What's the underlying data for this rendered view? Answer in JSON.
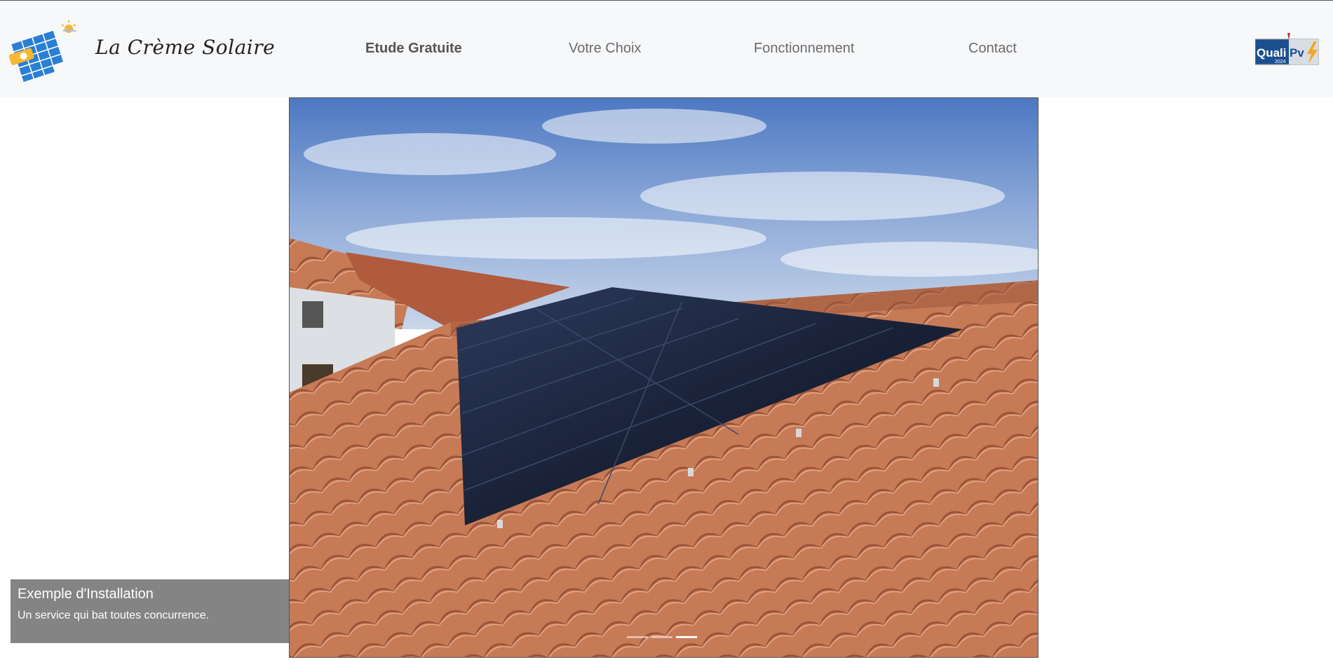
{
  "brand": {
    "name": "La Crème Solaire"
  },
  "nav": {
    "items": [
      {
        "label": "Etude Gratuite",
        "active": true
      },
      {
        "label": "Votre Choix",
        "active": false
      },
      {
        "label": "Fonctionnement",
        "active": false
      },
      {
        "label": "Contact",
        "active": false
      }
    ]
  },
  "badge": {
    "text_main": "Quali",
    "text_accent": "Pv",
    "year": "2024"
  },
  "hero": {
    "caption_title": "Exemple d'Installation",
    "caption_text": "Un service qui bat toutes concurrence.",
    "slides_total": 3,
    "active_slide": 3
  },
  "colors": {
    "navbar_bg": "#f7f8fa",
    "nav_text": "#6b6b6b",
    "caption_bg": "#6e6e6e",
    "badge_blue": "#1b4f8f",
    "badge_orange": "#f5a623",
    "logo_blue": "#2a7fd4"
  },
  "icons": {
    "logo": "solar-panel-sun-icon",
    "badge": "qualipv-badge-icon"
  }
}
